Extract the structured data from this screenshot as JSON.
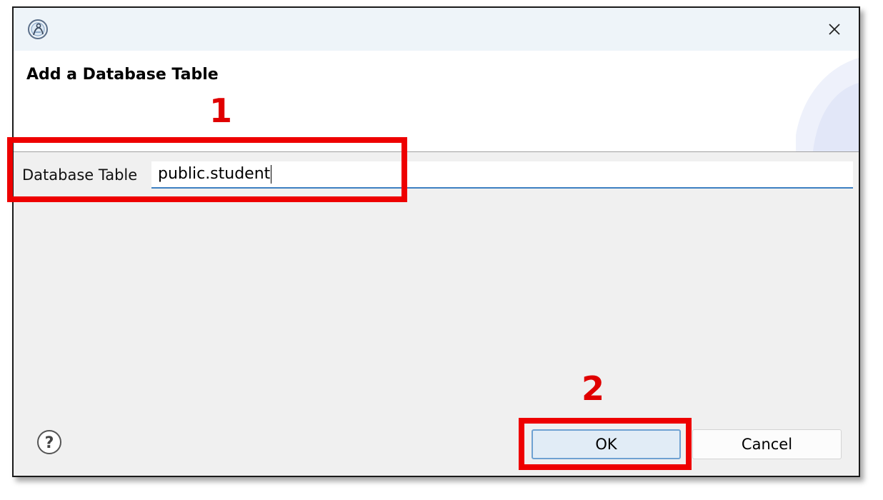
{
  "dialog": {
    "title": "Add a Database Table",
    "close_icon": "close-icon",
    "app_icon": "app-logo-icon"
  },
  "form": {
    "label": "Database Table",
    "value": "public.student"
  },
  "buttons": {
    "ok": "OK",
    "cancel": "Cancel",
    "help_icon": "help-icon"
  },
  "annotations": {
    "step1": "1",
    "step2": "2",
    "color": "#ee0000"
  }
}
